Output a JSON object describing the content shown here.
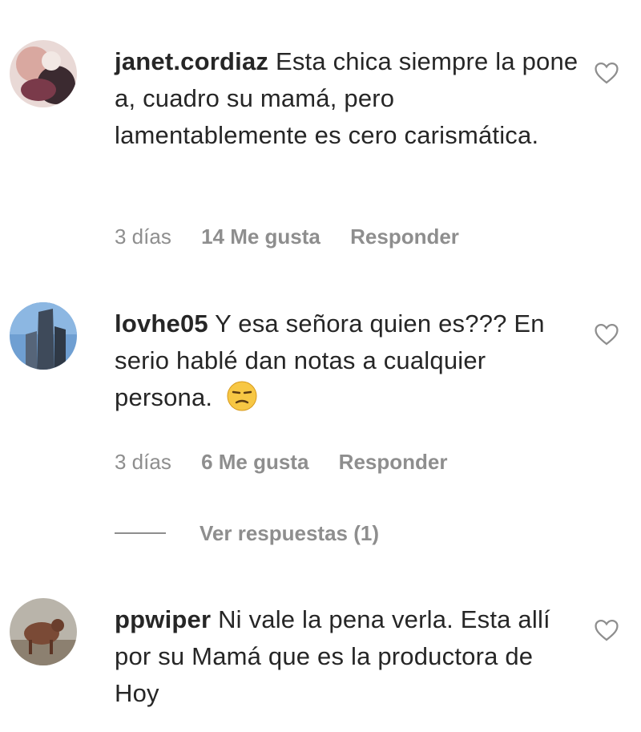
{
  "comments": [
    {
      "username": "janet.cordiaz",
      "text": "Esta chica siempre la pone a, cuadro su mamá, pero lamentablemente es cero carismática.",
      "time": "3 días",
      "likes": "14 Me gusta",
      "reply": "Responder",
      "avatar_icon": "profile-photo"
    },
    {
      "username": "lovhe05",
      "text": "Y esa señora quien es??? En serio hablé dan notas a cualquier persona.",
      "emoji": "unamused-face-emoji",
      "time": "3 días",
      "likes": "6 Me gusta",
      "reply": "Responder",
      "avatar_icon": "profile-photo"
    },
    {
      "username": "ppwiper",
      "text": "Ni vale la pena verla. Esta allí por su Mamá que es la productora de Hoy",
      "avatar_icon": "profile-photo"
    }
  ],
  "view_replies": "Ver respuestas (1)",
  "colors": {
    "username": "#262626",
    "secondary": "#8e8e8e",
    "background": "#ffffff"
  }
}
